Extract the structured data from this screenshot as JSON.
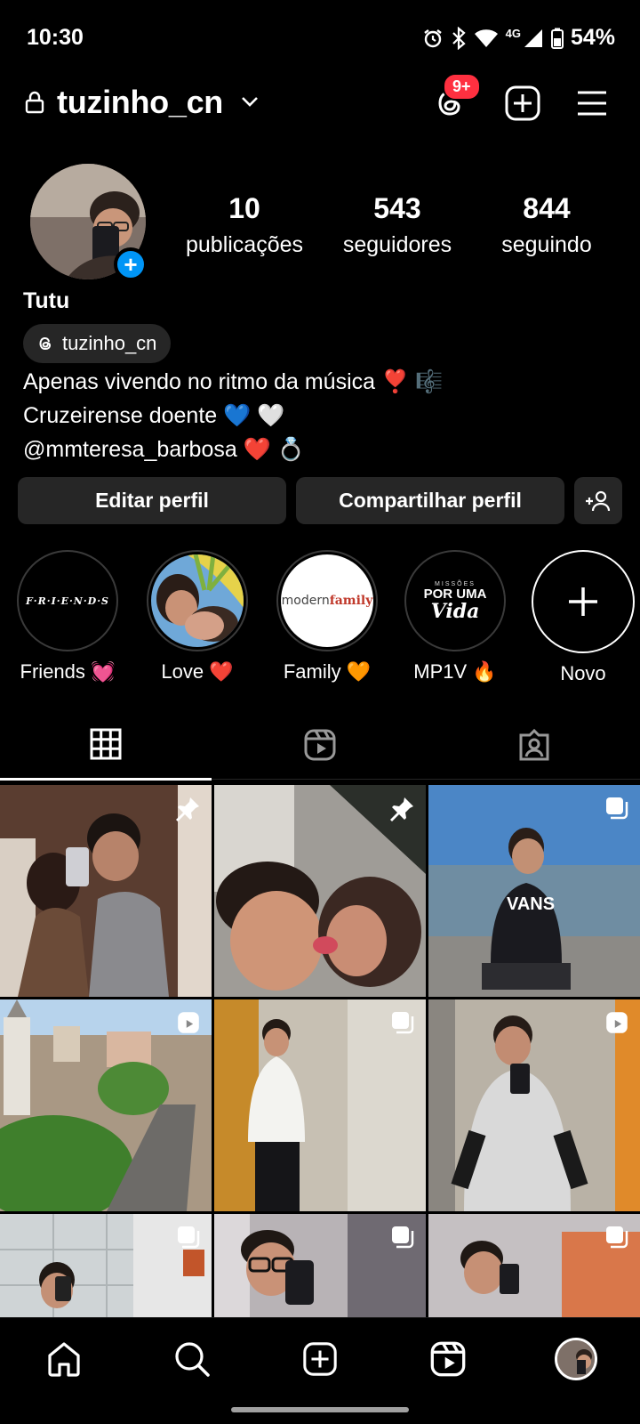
{
  "status_bar": {
    "time": "10:30",
    "network": "4G",
    "battery": "54%",
    "icons": [
      "alarm-icon",
      "bluetooth-icon",
      "wifi-icon",
      "signal-icon",
      "battery-icon"
    ]
  },
  "header": {
    "username": "tuzinho_cn",
    "threads_badge": "9+"
  },
  "profile": {
    "stats": {
      "posts_count": "10",
      "posts_label": "publicações",
      "followers_count": "543",
      "followers_label": "seguidores",
      "following_count": "844",
      "following_label": "seguindo"
    },
    "display_name": "Tutu",
    "threads_handle": "tuzinho_cn",
    "bio": {
      "line1_text": "Apenas vivendo no ritmo da música",
      "line1_emoji1": "❣️",
      "line1_emoji2": "🎼",
      "line2_text": "Cruzeirense doente",
      "line2_emoji1": "💙",
      "line2_emoji2": "🤍",
      "line3_text": "@mmteresa_barbosa",
      "line3_emoji1": "❤️",
      "line3_emoji2": "💍"
    }
  },
  "actions": {
    "edit_label": "Editar perfil",
    "share_label": "Compartilhar perfil"
  },
  "highlights": [
    {
      "label": "Friends",
      "emoji": "💓",
      "cover_text": "F·R·I·E·N·D·S"
    },
    {
      "label": "Love",
      "emoji": "❤️"
    },
    {
      "label": "Family",
      "emoji": "🧡",
      "cover_text_a": "modern",
      "cover_text_b": "family"
    },
    {
      "label": "MP1V",
      "emoji": "🔥",
      "cover_text_a": "MISSÕES",
      "cover_text_b": "POR UMA",
      "cover_text_c": "Vida"
    },
    {
      "label": "Novo"
    }
  ],
  "tabs": [
    "grid-icon",
    "reels-icon",
    "tagged-icon"
  ],
  "grid_posts": [
    {
      "type": "pinned"
    },
    {
      "type": "pinned"
    },
    {
      "type": "carousel"
    },
    {
      "type": "reel"
    },
    {
      "type": "carousel"
    },
    {
      "type": "reel"
    },
    {
      "type": "carousel"
    },
    {
      "type": "carousel"
    },
    {
      "type": "carousel"
    }
  ],
  "colors": {
    "background": "#000000",
    "button": "#262626",
    "accent": "#0095f6",
    "badge": "#ff3040"
  }
}
